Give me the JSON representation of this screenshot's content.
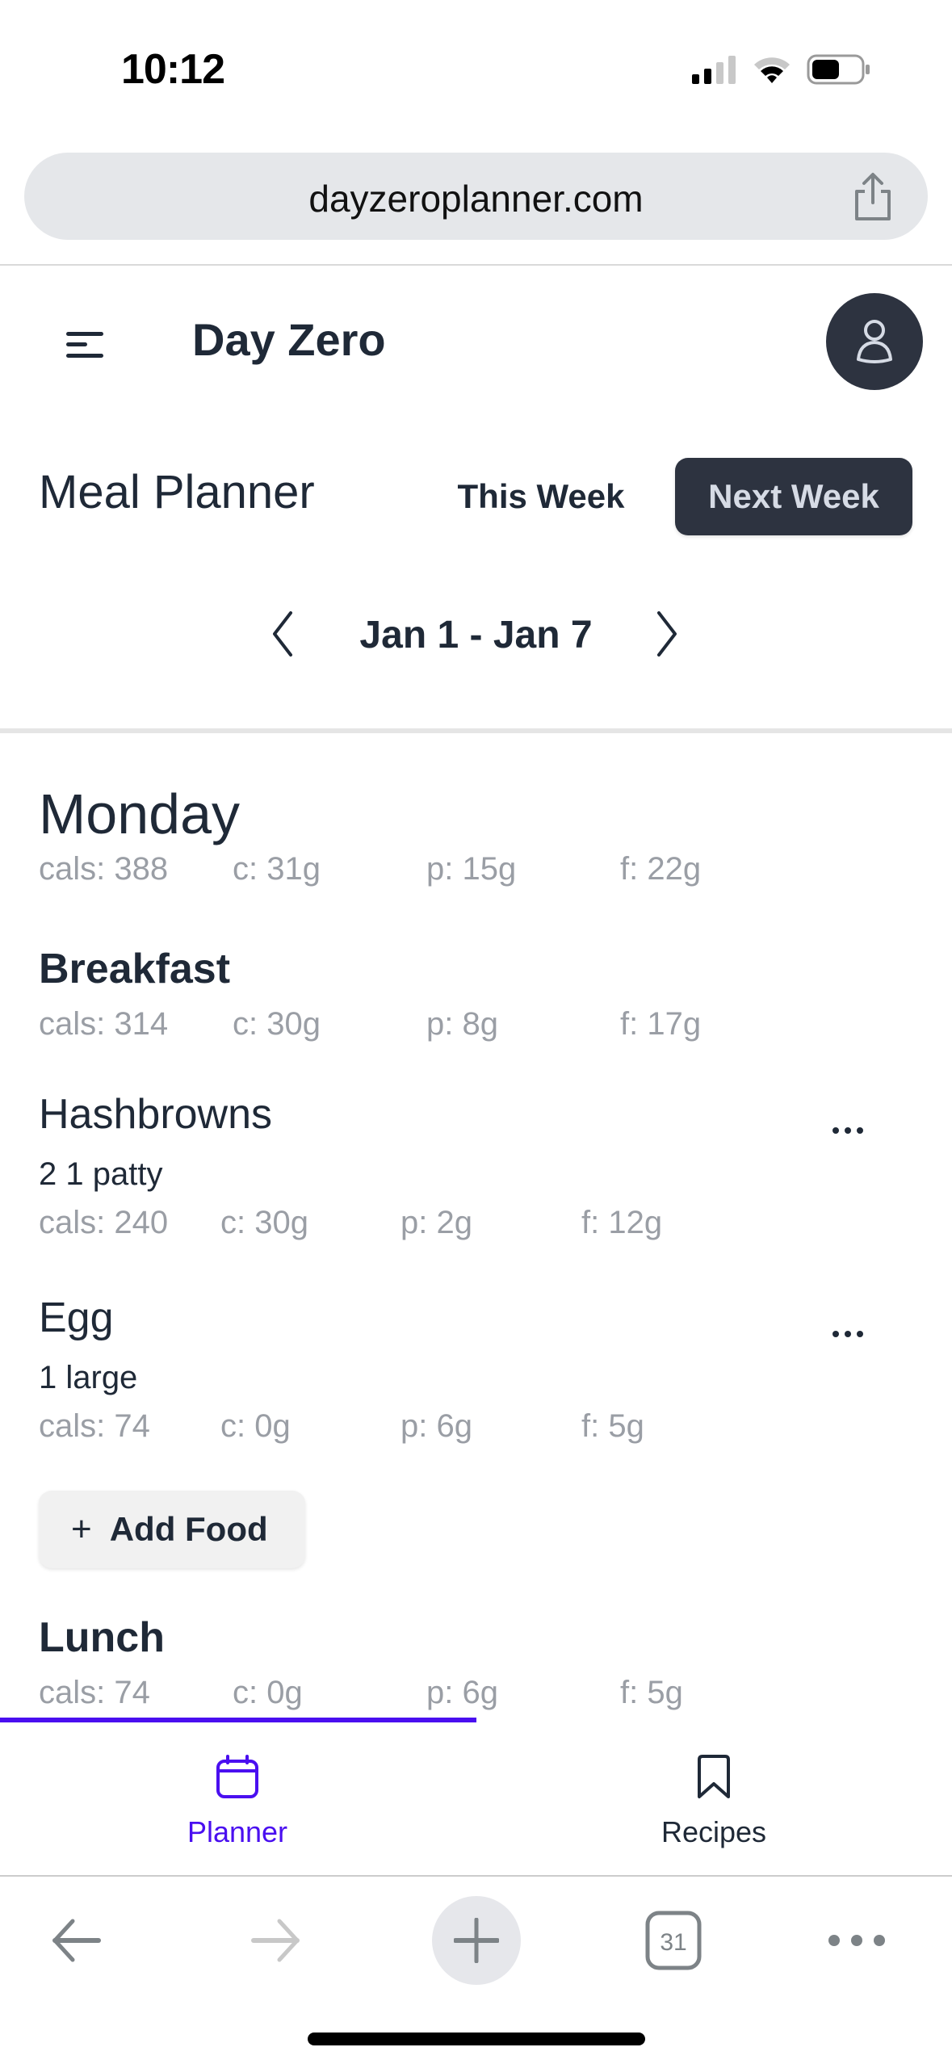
{
  "status_bar": {
    "time": "10:12",
    "signal_icon": "cellular-signal-icon",
    "wifi_icon": "wifi-icon",
    "battery_icon": "battery-icon"
  },
  "browser": {
    "url": "dayzeroplanner.com",
    "share_icon": "share-icon",
    "toolbar": {
      "back_icon": "arrow-left-icon",
      "forward_icon": "arrow-right-icon",
      "new_tab_icon": "plus-icon",
      "tab_count": "31",
      "more_icon": "ellipsis-icon"
    }
  },
  "app": {
    "title": "Day Zero",
    "menu_icon": "menu-icon",
    "avatar_icon": "user-icon"
  },
  "planner": {
    "page_title": "Meal Planner",
    "this_week_label": "This Week",
    "next_week_label": "Next Week",
    "week_range": "Jan 1 - Jan 7",
    "accent_color": "#4a0ff0",
    "dark_color": "#2d3340",
    "scroll_progress": 0.5
  },
  "day": {
    "name": "Monday",
    "macros": {
      "cals": "cals: 388",
      "c": "c: 31g",
      "p": "p: 15g",
      "f": "f: 22g"
    },
    "meals": [
      {
        "name": "Breakfast",
        "macros": {
          "cals": "cals: 314",
          "c": "c: 30g",
          "p": "p: 8g",
          "f": "f: 17g"
        },
        "foods": [
          {
            "name": "Hashbrowns",
            "quantity": "2 1 patty",
            "macros": {
              "cals": "cals: 240",
              "c": "c: 30g",
              "p": "p: 2g",
              "f": "f: 12g"
            }
          },
          {
            "name": "Egg",
            "quantity": "1 large",
            "macros": {
              "cals": "cals: 74",
              "c": "c: 0g",
              "p": "p: 6g",
              "f": "f: 5g"
            }
          }
        ],
        "add_food_label": "Add Food"
      },
      {
        "name": "Lunch",
        "macros": {
          "cals": "cals: 74",
          "c": "c: 0g",
          "p": "p: 6g",
          "f": "f: 5g"
        }
      }
    ]
  },
  "bottom_nav": {
    "items": [
      {
        "label": "Planner",
        "icon": "calendar-icon",
        "active": true
      },
      {
        "label": "Recipes",
        "icon": "bookmark-icon",
        "active": false
      }
    ]
  }
}
